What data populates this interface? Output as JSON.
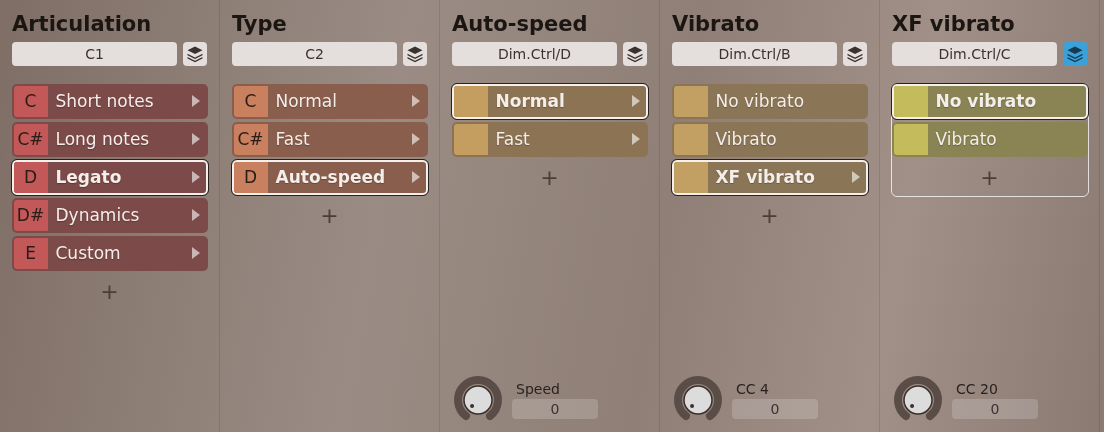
{
  "columns": [
    {
      "title": "Articulation",
      "field": "C1",
      "layers_active": false,
      "color": "#c25858",
      "items": [
        {
          "key": "C",
          "label": "Short notes",
          "selected": false,
          "arrow": true
        },
        {
          "key": "C#",
          "label": "Long notes",
          "selected": false,
          "arrow": true
        },
        {
          "key": "D",
          "label": "Legato",
          "selected": true,
          "arrow": true
        },
        {
          "key": "D#",
          "label": "Dynamics",
          "selected": false,
          "arrow": true
        },
        {
          "key": "E",
          "label": "Custom",
          "selected": false,
          "arrow": true
        }
      ],
      "add": "+"
    },
    {
      "title": "Type",
      "field": "C2",
      "layers_active": false,
      "color": "#c9805e",
      "items": [
        {
          "key": "C",
          "label": "Normal",
          "selected": false,
          "arrow": true
        },
        {
          "key": "C#",
          "label": "Fast",
          "selected": false,
          "arrow": true
        },
        {
          "key": "D",
          "label": "Auto-speed",
          "selected": true,
          "arrow": true
        }
      ],
      "add": "+"
    },
    {
      "title": "Auto-speed",
      "field": "Dim.Ctrl/D",
      "layers_active": false,
      "color": "#c49e60",
      "items": [
        {
          "label": "Normal",
          "selected": true,
          "arrow": true
        },
        {
          "label": "Fast",
          "selected": false,
          "arrow": true
        }
      ],
      "add": "+",
      "knob": {
        "label": "Speed",
        "value": "0"
      }
    },
    {
      "title": "Vibrato",
      "field": "Dim.Ctrl/B",
      "layers_active": false,
      "color": "#c2a064",
      "items": [
        {
          "label": "No vibrato",
          "selected": false,
          "arrow": false
        },
        {
          "label": "Vibrato",
          "selected": false,
          "arrow": false
        },
        {
          "label": "XF vibrato",
          "selected": true,
          "arrow": true
        }
      ],
      "add": "+",
      "knob": {
        "label": "CC 4",
        "value": "0"
      }
    },
    {
      "title": "XF vibrato",
      "field": "Dim.Ctrl/C",
      "layers_active": true,
      "color": "#c4bc5c",
      "outlined": true,
      "items": [
        {
          "label": "No vibrato",
          "selected": true,
          "arrow": false
        },
        {
          "label": "Vibrato",
          "selected": false,
          "arrow": false
        }
      ],
      "add": "+",
      "knob": {
        "label": "CC 20",
        "value": "0"
      }
    }
  ]
}
